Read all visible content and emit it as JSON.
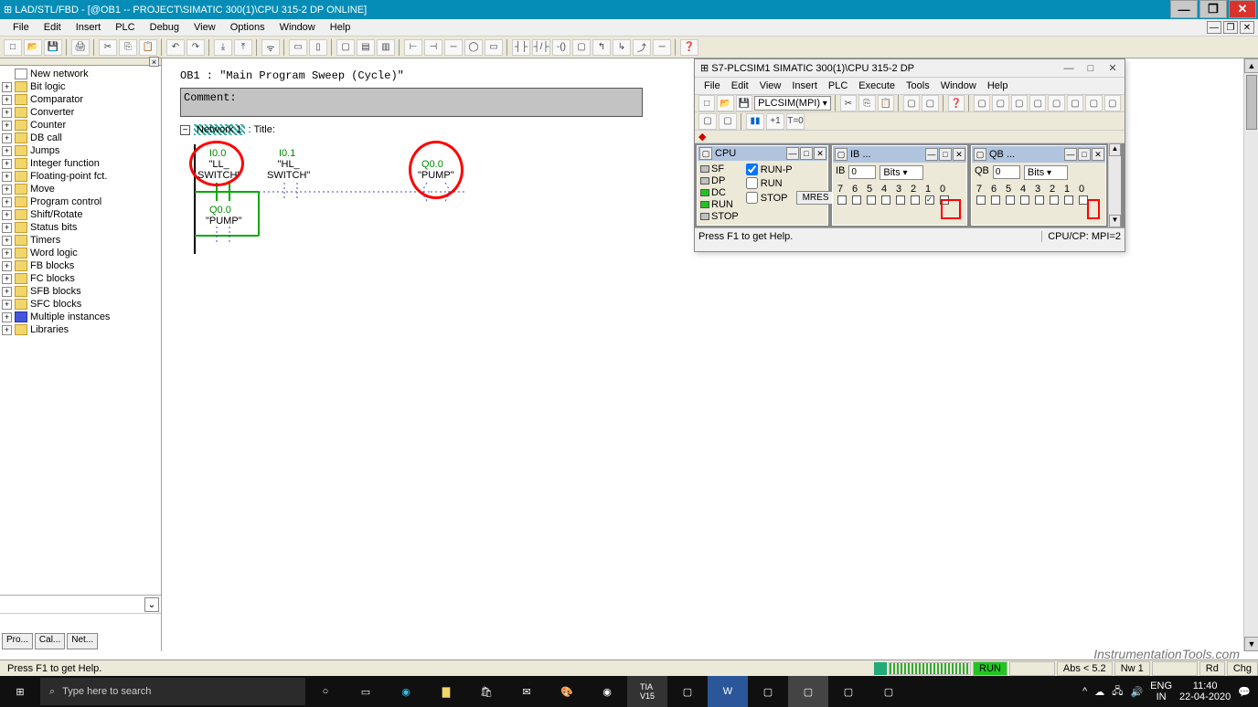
{
  "title": "LAD/STL/FBD  - [@OB1 -- PROJECT\\SIMATIC 300(1)\\CPU 315-2 DP  ONLINE]",
  "menu": [
    "File",
    "Edit",
    "Insert",
    "PLC",
    "Debug",
    "View",
    "Options",
    "Window",
    "Help"
  ],
  "tree": [
    {
      "icon": "ladder",
      "label": "New network"
    },
    {
      "icon": "fold",
      "label": "Bit logic"
    },
    {
      "icon": "fold",
      "label": "Comparator"
    },
    {
      "icon": "fold",
      "label": "Converter"
    },
    {
      "icon": "fold",
      "label": "Counter"
    },
    {
      "icon": "fold",
      "label": "DB call"
    },
    {
      "icon": "fold",
      "label": "Jumps"
    },
    {
      "icon": "fold",
      "label": "Integer function"
    },
    {
      "icon": "fold",
      "label": "Floating-point fct."
    },
    {
      "icon": "fold",
      "label": "Move"
    },
    {
      "icon": "fold",
      "label": "Program control"
    },
    {
      "icon": "fold",
      "label": "Shift/Rotate"
    },
    {
      "icon": "fold",
      "label": "Status bits"
    },
    {
      "icon": "fold",
      "label": "Timers"
    },
    {
      "icon": "fold",
      "label": "Word logic"
    },
    {
      "icon": "fold",
      "label": "FB blocks"
    },
    {
      "icon": "fold",
      "label": "FC blocks"
    },
    {
      "icon": "fold",
      "label": "SFB blocks"
    },
    {
      "icon": "fold",
      "label": "SFC blocks"
    },
    {
      "icon": "inst",
      "label": "Multiple instances"
    },
    {
      "icon": "fold",
      "label": "Libraries"
    }
  ],
  "side_tabs": [
    "Pro...",
    "Cal...",
    "Net..."
  ],
  "editor": {
    "ob_title": "OB1 :  \"Main Program Sweep (Cycle)\"",
    "comment_label": "Comment:",
    "network_label": "Network 1",
    "title_suffix": ": Title:",
    "contacts": {
      "i00": {
        "addr": "I0.0",
        "sym": "\"LL_\nSWITCH\""
      },
      "i01": {
        "addr": "I0.1",
        "sym": "\"HL_\nSWITCH\""
      },
      "q00": {
        "addr": "Q0.0",
        "sym": "\"PUMP\""
      },
      "q00b": {
        "addr": "Q0.0",
        "sym": "\"PUMP\""
      }
    }
  },
  "sim": {
    "title": "S7-PLCSIM1    SIMATIC 300(1)\\CPU 315-2 DP",
    "menu": [
      "File",
      "Edit",
      "View",
      "Insert",
      "PLC",
      "Execute",
      "Tools",
      "Window",
      "Help"
    ],
    "combo": "PLCSIM(MPI)",
    "cpu": {
      "hdr": "CPU",
      "leds": [
        {
          "c": "#c0c0c0",
          "t": "SF"
        },
        {
          "c": "#c0c0c0",
          "t": "DP"
        },
        {
          "c": "#22c41f",
          "t": "DC"
        },
        {
          "c": "#22c41f",
          "t": "RUN"
        },
        {
          "c": "#c0c0c0",
          "t": "STOP"
        }
      ],
      "runp": "RUN-P",
      "run": "RUN",
      "stop": "STOP",
      "mres": "MRES"
    },
    "ib": {
      "hdr": "IB  ...",
      "field": "IB",
      "val": "0",
      "fmt": "Bits",
      "bits": [
        "7",
        "6",
        "5",
        "4",
        "3",
        "2",
        "1",
        "0"
      ]
    },
    "qb": {
      "hdr": "QB ...",
      "field": "QB",
      "val": "0",
      "fmt": "Bits",
      "bits": [
        "7",
        "6",
        "5",
        "4",
        "3",
        "2",
        "1",
        "0"
      ]
    },
    "status_l": "Press F1 to get Help.",
    "status_r": "CPU/CP: MPI=2"
  },
  "status": {
    "help": "Press F1 to get Help.",
    "abs": "Abs < 5.2",
    "nw": "Nw 1",
    "run": "RUN",
    "rd": "Rd",
    "chg": "Chg"
  },
  "taskbar": {
    "search_placeholder": "Type here to search",
    "lang1": "ENG",
    "lang2": "IN",
    "time": "11:40",
    "date": "22-04-2020"
  },
  "watermark": "InstrumentationTools.com"
}
